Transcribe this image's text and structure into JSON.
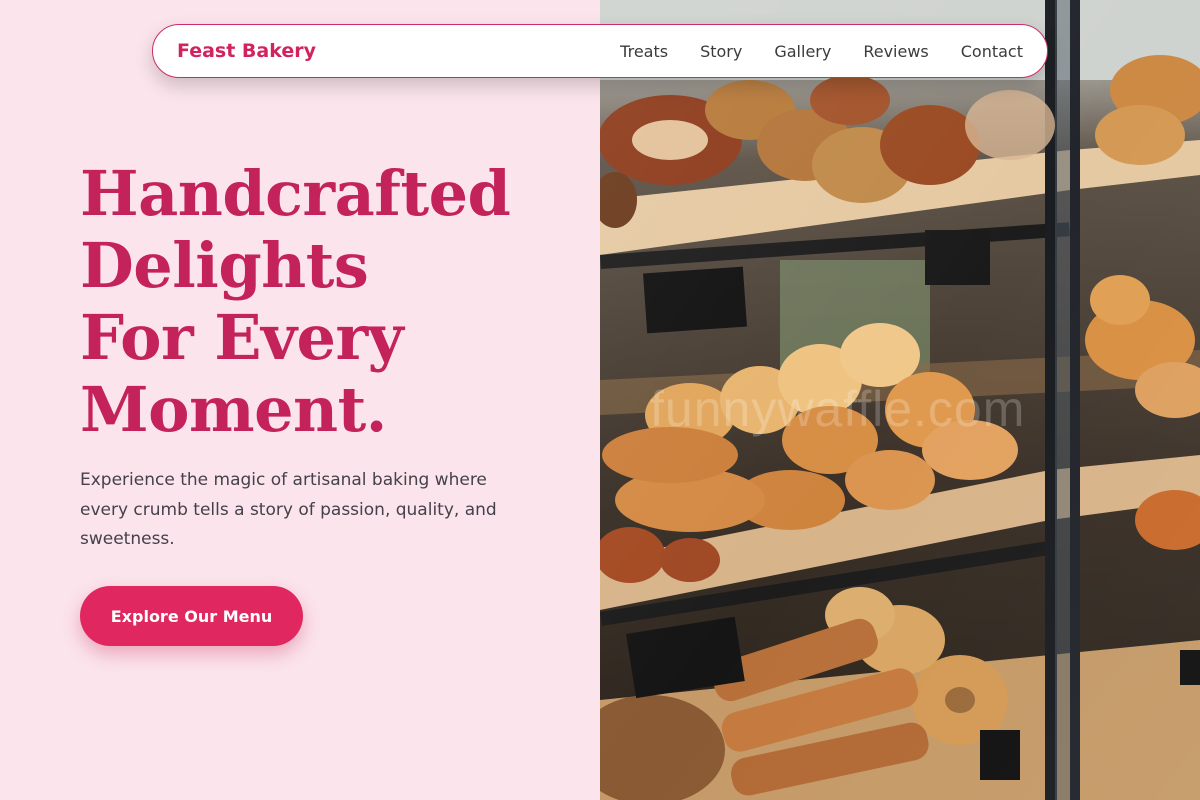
{
  "header": {
    "brand": "Feast Bakery",
    "nav": [
      "Treats",
      "Story",
      "Gallery",
      "Reviews",
      "Contact"
    ]
  },
  "hero": {
    "title_lines": [
      "Handcrafted",
      "Delights",
      "For Every",
      "Moment."
    ],
    "description": "Experience the magic of artisanal baking where every crumb tells a story of passion, quality, and sweetness.",
    "cta_label": "Explore Our Menu"
  },
  "photo": {
    "subject": "bakery display case with breads and pastries",
    "watermark": "funnywaffle.com"
  },
  "colors": {
    "background": "#fbe4ec",
    "accent": "#e0275f",
    "title": "#c4225a"
  }
}
